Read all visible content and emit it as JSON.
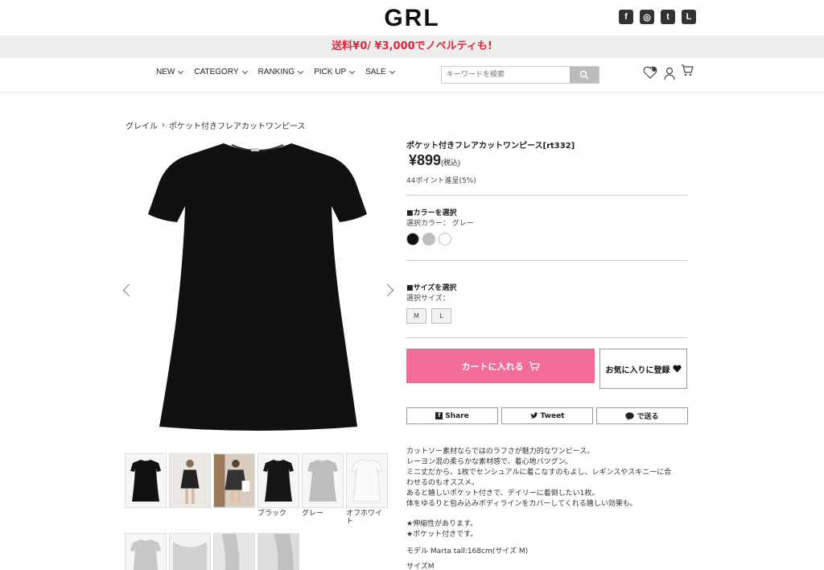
{
  "header": {
    "logo": "GRL",
    "promo": "送料¥0/ ¥3,000でノベルティも!",
    "social": [
      {
        "icon": "facebook-icon",
        "glyph": "f"
      },
      {
        "icon": "instagram-icon",
        "glyph": "◎"
      },
      {
        "icon": "twitter-icon",
        "glyph": "t"
      },
      {
        "icon": "line-icon",
        "glyph": "L"
      }
    ],
    "nav": [
      "NEW",
      "CATEGORY",
      "RANKING",
      "PICK UP",
      "SALE"
    ],
    "search_placeholder": "キーワードを検索"
  },
  "breadcrumb": {
    "home": "グレイル",
    "current": "ポケット付きフレアカットワンピース"
  },
  "product": {
    "name": "ポケット付きフレアカットワンピース[rt332]",
    "price": "¥899",
    "tax": "(税込)",
    "points": "44ポイント進呈(5%)",
    "color_heading": "■カラーを選択",
    "color_selected": "選択カラー： グレー",
    "colors": [
      "#111111",
      "#bdbdbd",
      "#ffffff"
    ],
    "size_heading": "■サイズを選択",
    "size_selected": "選択サイズ：",
    "sizes": [
      "M",
      "L"
    ],
    "cart_label": "カートに入れる",
    "fav_label": "お気に入りに登録",
    "share": [
      "Share",
      "Tweet",
      "で送る"
    ]
  },
  "thumbnails": {
    "labels": [
      "",
      "",
      "",
      "ブラック",
      "グレー",
      "オフホワイト"
    ]
  },
  "description": {
    "lines1": [
      "カットソー素材ならではのラフさが魅力的なワンピース。",
      "レーヨン混の柔らかな素材感で、着心地バツグン。",
      "ミニ丈だから、1枚でセンシュアルに着こなすのもよし、レギンスやスキニーに合",
      "わせるのもオススメ。",
      "あると嬉しいポケット付きで、デイリーに着倒したい1枚。",
      "体をゆるりと包み込みボディラインをカバーしてくれる嬉しい効果も。"
    ],
    "lines2": [
      "★伸縮性があります。",
      "★ポケット付きです。"
    ],
    "model": "モデル Marta tall:168cm(サイズ M)",
    "size_line": "サイズM"
  },
  "colors": {
    "accent_pink": "#f26b9b",
    "promo_red": "#e0263a"
  }
}
